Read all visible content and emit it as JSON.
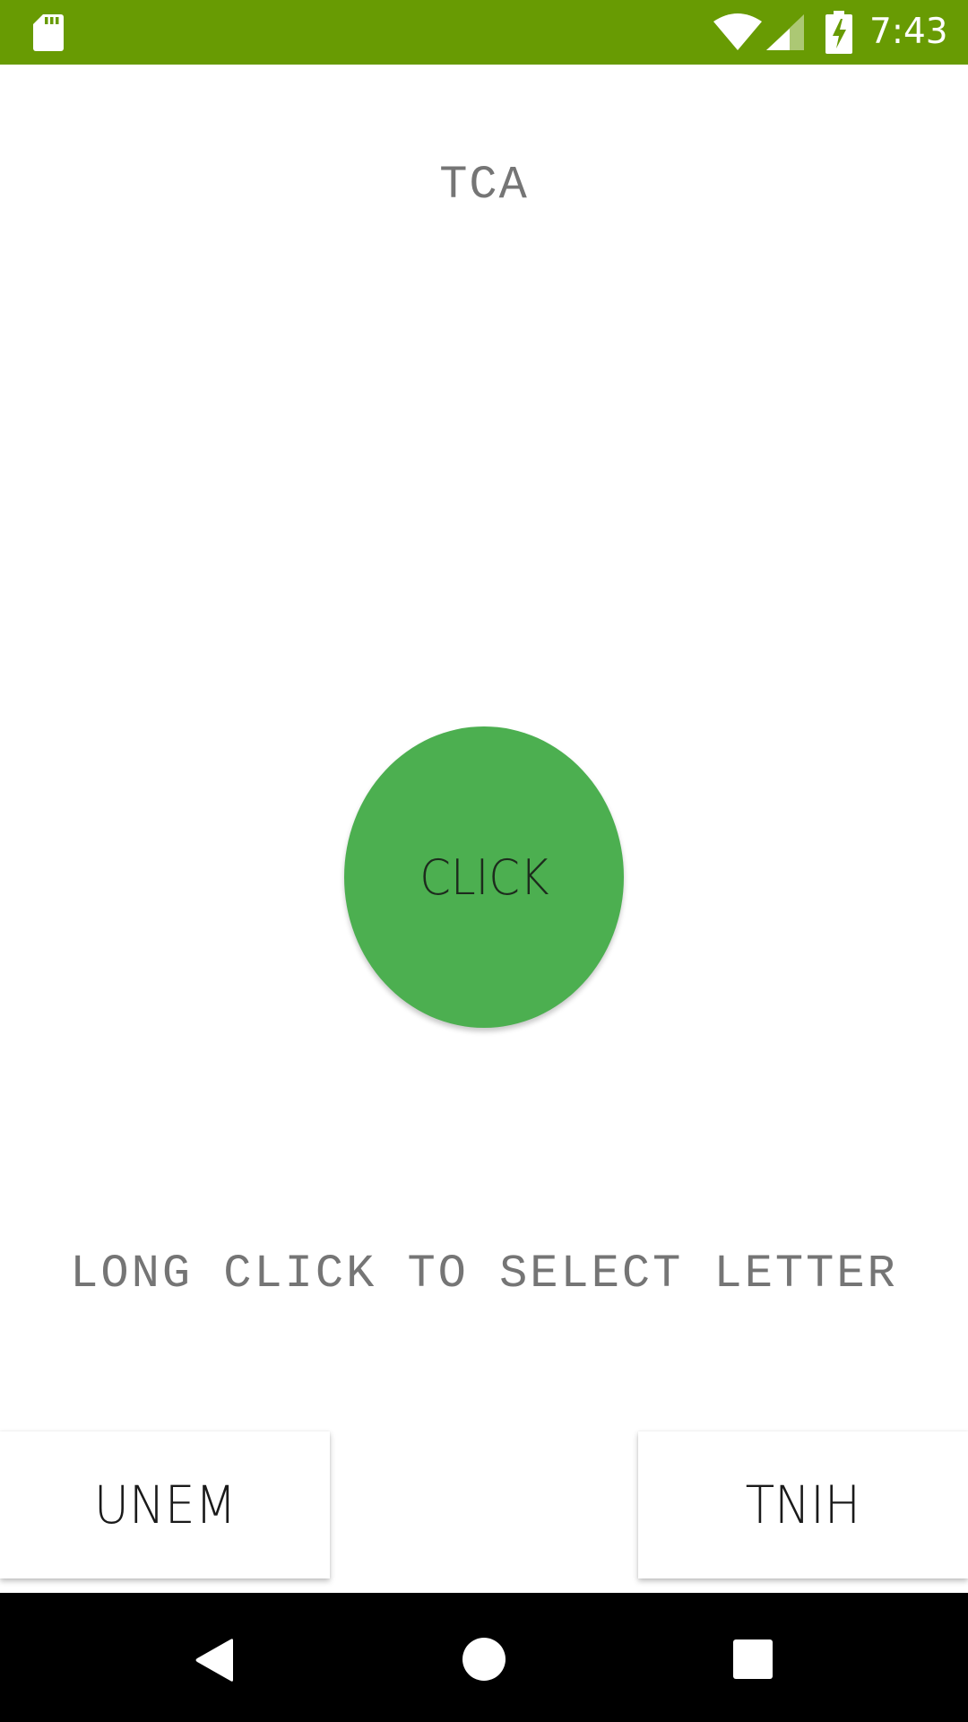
{
  "status_bar": {
    "time": "7:43",
    "background_color": "#689b03",
    "icons": [
      "sd-card-icon",
      "wifi-icon",
      "cell-signal-icon",
      "battery-charging-icon"
    ]
  },
  "main": {
    "title": "TCA",
    "button_label": "CLICK",
    "button_color": "#4caf50",
    "hint": "LONG CLICK TO SELECT LETTER"
  },
  "bottom_buttons": {
    "menu_label": "UNEM",
    "hint_label": "TNIH"
  },
  "nav_bar": {
    "icons": [
      "back-icon",
      "home-icon",
      "recents-icon"
    ]
  }
}
